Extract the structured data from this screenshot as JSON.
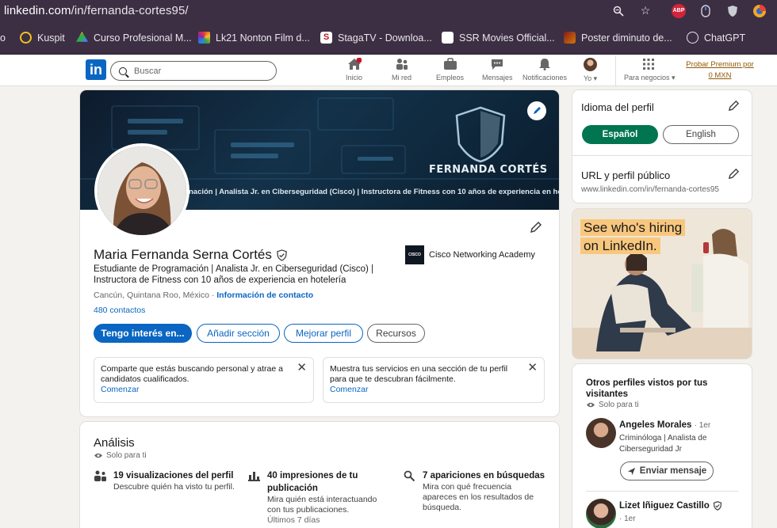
{
  "browser": {
    "url_host": "linkedin.com",
    "url_path": "/in/fernanda-cortes95/",
    "bookmarks": [
      {
        "label": "o",
        "color": "#3c2f44"
      },
      {
        "label": "Kuspit",
        "color": "#f0c419"
      },
      {
        "label": "Curso Profesional M...",
        "color": "#34a853"
      },
      {
        "label": "Lk21 Nonton Film d...",
        "color": "#c2185b"
      },
      {
        "label": "StagaTV - Downloa...",
        "color": "#ffffff"
      },
      {
        "label": "SSR Movies Official...",
        "color": "#ffffff"
      },
      {
        "label": "Poster diminuto de...",
        "color": "#b71c1c"
      },
      {
        "label": "ChatGPT",
        "color": "#e8e6ea"
      }
    ],
    "abp_label": "ABP"
  },
  "nav": {
    "logo": "in",
    "search_placeholder": "Buscar",
    "items": [
      "Inicio",
      "Mi red",
      "Empleos",
      "Mensajes",
      "Notificaciones",
      "Yo ▾",
      "Para negocios ▾"
    ],
    "premium": "Probar Premium por 0 MXN"
  },
  "profile": {
    "banner_name": "FERNANDA CORTÉS",
    "banner_tagline": "nación | Analista Jr. en Ciberseguridad (Cisco) | Instructora de Fitness con 10 años de experiencia en hotelería",
    "name": "Maria Fernanda Serna Cortés",
    "headline": "Estudiante de Programación | Analista Jr. en Ciberseguridad (Cisco) | Instructora de Fitness con 10 años de experiencia en hotelería",
    "location": "Cancún, Quintana Roo, México",
    "location_sep": " · ",
    "contact_info": "Información de contacto",
    "connections": "480 contactos",
    "company": "Cisco Networking Academy",
    "company_logo": "CISCO",
    "actions": [
      "Tengo interés en...",
      "Añadir sección",
      "Mejorar perfil",
      "Recursos"
    ],
    "hints": [
      {
        "text": "Comparte que estás buscando personal y atrae a candidatos cualificados.",
        "link": "Comenzar"
      },
      {
        "text": "Muestra tus servicios en una sección de tu perfil para que te descubran fácilmente.",
        "link": "Comenzar"
      }
    ]
  },
  "analytics": {
    "title": "Análisis",
    "private": "Solo para ti",
    "stats": [
      {
        "title": "19 visualizaciones del perfil",
        "desc": "Descubre quién ha visto tu perfil."
      },
      {
        "title": "40 impresiones de tu publicación",
        "desc": "Mira quién está interactuando con tus publicaciones.",
        "extra": "Últimos 7 días"
      },
      {
        "title": "7 apariciones en búsquedas",
        "desc": "Mira con qué frecuencia apareces en los resultados de búsqueda."
      }
    ]
  },
  "sidebar": {
    "lang_title": "Idioma del perfil",
    "lang_options": [
      "Español",
      "English"
    ],
    "url_title": "URL y perfil público",
    "url_value": "www.linkedin.com/in/fernanda-cortes95",
    "ad_line1": "See who's hiring",
    "ad_line2": "on LinkedIn.",
    "viewers_title": "Otros perfiles vistos por tus visitantes",
    "viewers_private": "Solo para ti",
    "people": [
      {
        "name": "Angeles Morales",
        "degree": "· 1er",
        "headline": "Criminóloga | Analista de Ciberseguridad Jr",
        "action": "Enviar mensaje"
      },
      {
        "name": "Lizet Iñiguez Castillo",
        "degree": "· 1er"
      }
    ]
  },
  "colors": {
    "brand": "#0a66c2",
    "green": "#01754f",
    "premium": "#915907"
  }
}
